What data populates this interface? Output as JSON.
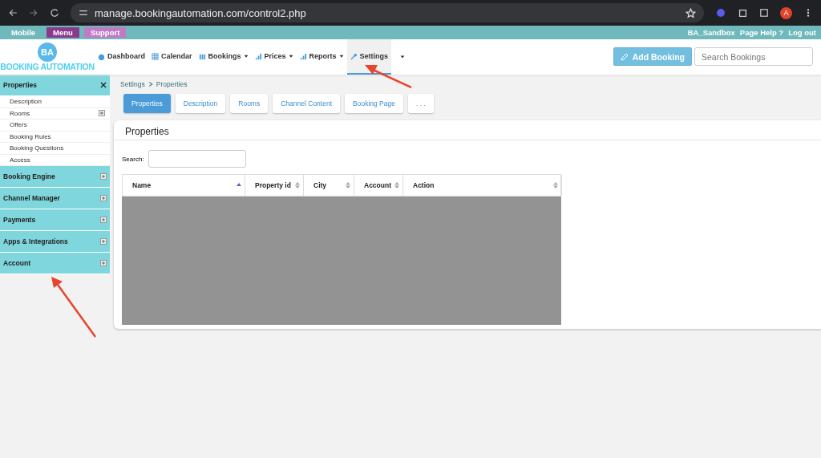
{
  "browser": {
    "url": "manage.bookingautomation.com/control2.php",
    "avatar": "A"
  },
  "topbar": {
    "left": [
      {
        "label": "Mobile",
        "kind": "plain"
      },
      {
        "label": "Menu",
        "kind": "menu"
      },
      {
        "label": "Support",
        "kind": "support"
      }
    ],
    "right": [
      "BA_Sandbox",
      "Page Help ?",
      "Log out"
    ]
  },
  "logo": {
    "initials": "BA",
    "name": "BOOKING AUTOMATION"
  },
  "nav": [
    {
      "label": "Dashboard",
      "dropdown": false,
      "selected": false
    },
    {
      "label": "Calendar",
      "dropdown": false,
      "selected": false
    },
    {
      "label": "Bookings",
      "dropdown": true,
      "selected": false
    },
    {
      "label": "Prices",
      "dropdown": true,
      "selected": false
    },
    {
      "label": "Reports",
      "dropdown": true,
      "selected": false
    },
    {
      "label": "Settings",
      "dropdown": false,
      "selected": true
    }
  ],
  "add_booking": "Add Booking",
  "search_bookings": {
    "placeholder": "Search Bookings"
  },
  "sidebar": [
    {
      "label": "Properties",
      "expanded": true,
      "children": [
        {
          "label": "Description",
          "expandable": false
        },
        {
          "label": "Rooms",
          "expandable": true
        },
        {
          "label": "Offers",
          "expandable": false
        },
        {
          "label": "Booking Rules",
          "expandable": false
        },
        {
          "label": "Booking Questions",
          "expandable": false
        },
        {
          "label": "Access",
          "expandable": false
        }
      ]
    },
    {
      "label": "Booking Engine",
      "expanded": false
    },
    {
      "label": "Channel Manager",
      "expanded": false
    },
    {
      "label": "Payments",
      "expanded": false
    },
    {
      "label": "Apps & Integrations",
      "expanded": false
    },
    {
      "label": "Account",
      "expanded": false
    }
  ],
  "breadcrumb": [
    "Settings",
    "Properties"
  ],
  "tabs": [
    {
      "label": "Properties",
      "selected": true
    },
    {
      "label": "Description",
      "selected": false
    },
    {
      "label": "Rooms",
      "selected": false
    },
    {
      "label": "Channel Content",
      "selected": false
    },
    {
      "label": "Booking Page",
      "selected": false
    },
    {
      "label": ". . .",
      "selected": false
    }
  ],
  "panel": {
    "title": "Properties",
    "search_label": "Search:"
  },
  "table": {
    "columns": [
      {
        "label": "Name",
        "sorted": true
      },
      {
        "label": "Property id",
        "sorted": false
      },
      {
        "label": "City",
        "sorted": false
      },
      {
        "label": "Account",
        "sorted": false
      },
      {
        "label": "Action",
        "sorted": false
      }
    ]
  }
}
